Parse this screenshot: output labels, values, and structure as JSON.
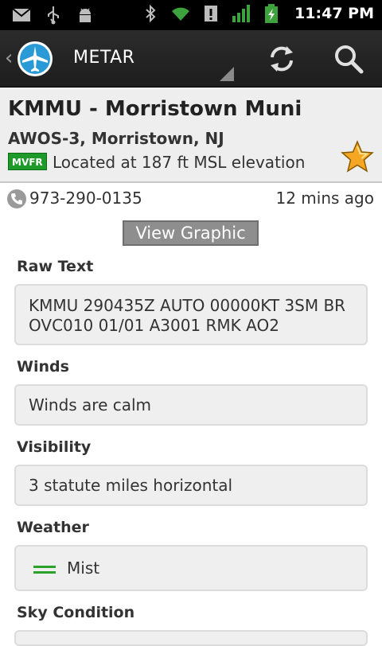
{
  "status_bar": {
    "time": "11:47 PM",
    "icons": [
      "gmail-icon",
      "usb-icon",
      "android-debug-icon",
      "bluetooth-icon",
      "wifi-icon",
      "alert-icon",
      "signal-icon",
      "battery-charging-icon"
    ]
  },
  "action_bar": {
    "title": "METAR",
    "logo": "airplane-logo-icon",
    "actions": [
      "refresh-icon",
      "search-icon"
    ]
  },
  "station": {
    "title": "KMMU - Morristown Muni",
    "subtitle": "AWOS-3, Morristown, NJ",
    "flight_category": "MVFR",
    "flight_category_color": "#1e9a2a",
    "elevation_text": "Located at 187 ft MSL elevation",
    "favorite_icon": "star-icon",
    "phone": "973-290-0135",
    "age": "12 mins ago"
  },
  "view_graphic_label": "View Graphic",
  "sections": {
    "raw": {
      "label": "Raw Text",
      "value": "KMMU 290435Z AUTO 00000KT 3SM BR OVC010 01/01 A3001 RMK AO2"
    },
    "winds": {
      "label": "Winds",
      "value": "Winds are calm"
    },
    "visibility": {
      "label": "Visibility",
      "value": "3 statute miles horizontal"
    },
    "weather": {
      "label": "Weather",
      "value": "Mist",
      "icon": "mist-icon"
    },
    "sky": {
      "label": "Sky Condition"
    }
  }
}
